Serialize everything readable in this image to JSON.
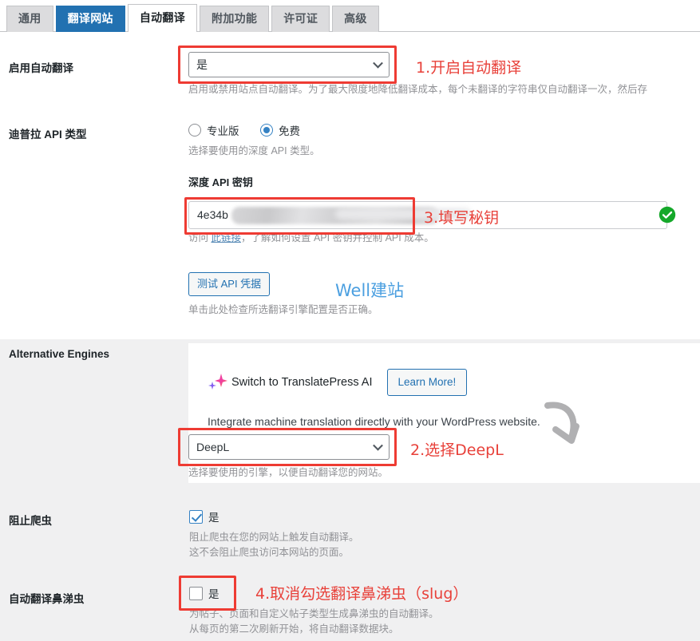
{
  "tabs": [
    {
      "label": "通用",
      "state": "inactive"
    },
    {
      "label": "翻译网站",
      "state": "highlighted"
    },
    {
      "label": "自动翻译",
      "state": "current"
    },
    {
      "label": "附加功能",
      "state": "inactive"
    },
    {
      "label": "许可证",
      "state": "inactive"
    },
    {
      "label": "高级",
      "state": "inactive"
    }
  ],
  "rows": {
    "enable_auto_translation": {
      "label": "启用自动翻译",
      "select_value": "是",
      "description": "启用或禁用站点自动翻译。为了最大限度地降低翻译成本，每个未翻译的字符串仅自动翻译一次，然后存"
    },
    "deepl_api_type": {
      "label": "迪普拉 API 类型",
      "option_pro": "专业版",
      "option_free": "免费",
      "selected": "免费",
      "description": "选择要使用的深度 API 类型。"
    },
    "api_key": {
      "subheading": "深度 API 密钥",
      "value_prefix": "4e34b",
      "desc_before": "访问 ",
      "desc_link": "此链接",
      "desc_after": "，了解如何设置 API 密钥并控制 API 成本。",
      "status_icon": "valid-check-icon"
    },
    "test_api": {
      "button_label": "测试 API 凭据",
      "description": "单击此处检查所选翻译引擎配置是否正确。"
    },
    "alternative_engines": {
      "label": "Alternative Engines",
      "promo_title": "Switch to TranslatePress AI",
      "promo_button": "Learn More!",
      "promo_subtitle": "Integrate machine translation directly with your WordPress website.",
      "engine_value": "DeepL",
      "engine_description": "选择要使用的引擎，以便自动翻译您的网站。"
    },
    "block_crawlers": {
      "label": "阻止爬虫",
      "checkbox_label": "是",
      "checked": true,
      "description_line1": "阻止爬虫在您的网站上触发自动翻译。",
      "description_line2": "这不会阻止爬虫访问本网站的页面。"
    },
    "auto_translate_slugs": {
      "label": "自动翻译鼻涕虫",
      "checkbox_label": "是",
      "checked": false,
      "description_line1": "为帖子、页面和自定义帖子类型生成鼻涕虫的自动翻译。",
      "description_line2": "从每页的第二次刷新开始，将自动翻译数据块。"
    }
  },
  "annotations": {
    "step1": "1.开启自动翻译",
    "step2": "2.选择DeepL",
    "step3": "3.填写秘钥",
    "step4": "4.取消勾选翻译鼻涕虫（slug）",
    "watermark": "Well建站",
    "box_color": "#ee3b33",
    "text_color": "#e8413a",
    "watermark_color": "#4b9fe0"
  }
}
